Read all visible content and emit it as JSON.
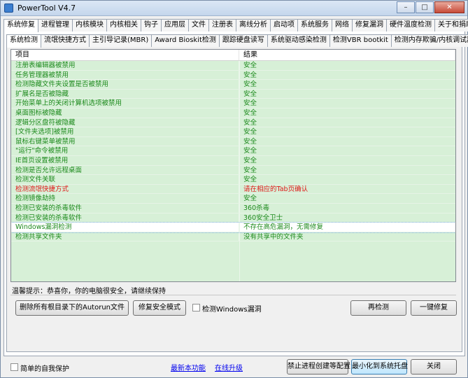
{
  "window": {
    "title": "PowerTool V4.7",
    "minimize": "–",
    "maximize": "□",
    "close": "✕"
  },
  "main_tabs": [
    "系统修复",
    "进程管理",
    "内核模块",
    "内核相关",
    "钩子",
    "应用层",
    "文件",
    "注册表",
    "离线分析",
    "启动项",
    "系统服务",
    "网络",
    "修复漏洞",
    "硬件温度检测",
    "关于和捐助"
  ],
  "active_main_tab": 0,
  "sub_tabs": [
    "系统检测",
    "流氓快捷方式",
    "主引导记录(MBR)",
    "Award Bioskit检测",
    "跟踪硬盘读写",
    "系统驱动感染检测",
    "检测VBR bootkit",
    "检测内存欺骗/内核调试器"
  ],
  "active_sub_tab": 0,
  "table": {
    "headers": [
      "项目",
      "结果"
    ],
    "rows": [
      {
        "item": "注册表编辑器被禁用",
        "result": "安全",
        "color": "#1d8a1d"
      },
      {
        "item": "任务管理器被禁用",
        "result": "安全",
        "color": "#1d8a1d"
      },
      {
        "item": "检测隐藏文件夹设置是否被禁用",
        "result": "安全",
        "color": "#1d8a1d"
      },
      {
        "item": "扩展名是否被隐藏",
        "result": "安全",
        "color": "#1d8a1d"
      },
      {
        "item": "开始菜单上的关闭计算机选项被禁用",
        "result": "安全",
        "color": "#1d8a1d"
      },
      {
        "item": "桌面图标被隐藏",
        "result": "安全",
        "color": "#1d8a1d"
      },
      {
        "item": "逻辑分区盘符被隐藏",
        "result": "安全",
        "color": "#1d8a1d"
      },
      {
        "item": "[文件夹选项]被禁用",
        "result": "安全",
        "color": "#1d8a1d"
      },
      {
        "item": "鼠标右键菜单被禁用",
        "result": "安全",
        "color": "#1d8a1d"
      },
      {
        "item": "\"运行\"命令被禁用",
        "result": "安全",
        "color": "#1d8a1d"
      },
      {
        "item": "IE首页设置被禁用",
        "result": "安全",
        "color": "#1d8a1d"
      },
      {
        "item": "检测是否允许远程桌面",
        "result": "安全",
        "color": "#1d8a1d"
      },
      {
        "item": "检测文件关联",
        "result": "安全",
        "color": "#1d8a1d"
      },
      {
        "item": "检测流氓快捷方式",
        "result": "请在相应的Tab页确认",
        "color": "#e01818"
      },
      {
        "item": "检测镜像劫持",
        "result": "安全",
        "color": "#1d8a1d"
      },
      {
        "item": "检测已安装的杀毒软件",
        "result": "360杀毒",
        "color": "#1d8a1d"
      },
      {
        "item": "检测已安装的杀毒软件",
        "result": "360安全卫士",
        "color": "#1d8a1d"
      },
      {
        "item": "Windows漏洞检测",
        "result": "不存在高危漏洞，无需修复",
        "color": "#1d8a1d",
        "selected": true
      },
      {
        "item": "检测共享文件夹",
        "result": "没有共享中的文件夹",
        "color": "#1d8a1d"
      }
    ]
  },
  "hint": "温馨提示：恭喜你，你的电脑很安全，请继续保持",
  "buttons": {
    "delete_autorun": "删除所有根目录下的Autorun文件",
    "repair_safe_mode": "修复安全模式",
    "detect_windows_vuln": "检测Windows漏洞",
    "recheck": "再检测",
    "one_key_fix": "一键修复",
    "block_process": "禁止进程创建等配置",
    "minimize_tray": "最小化到系统托盘",
    "close": "关闭"
  },
  "footer": {
    "self_protect": "简单的自我保护",
    "new_features": "最新本功能",
    "online_upgrade": "在线升级"
  }
}
